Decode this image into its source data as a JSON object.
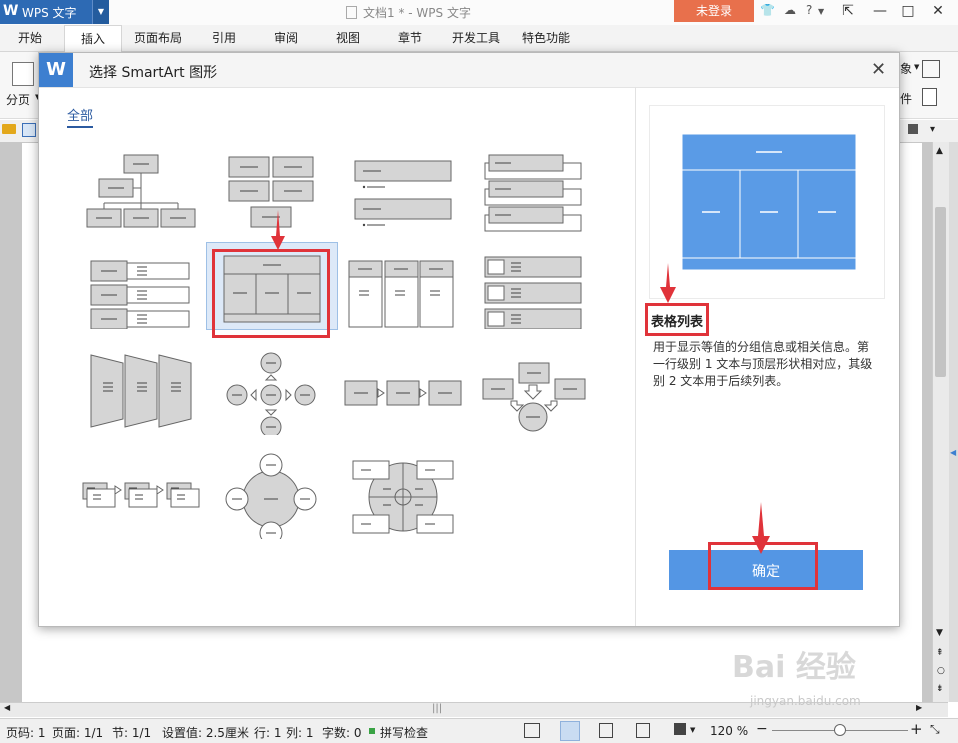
{
  "app": {
    "logo": "W",
    "name": "WPS 文字",
    "doc_title": "文档1 * - WPS 文字",
    "login": "未登录",
    "help": "?"
  },
  "tabs": [
    "开始",
    "插入",
    "页面布局",
    "引用",
    "审阅",
    "视图",
    "章节",
    "开发工具",
    "特色功能"
  ],
  "active_tab": "插入",
  "ribbon": {
    "page_break": "分页"
  },
  "dialog": {
    "title": "选择 SmartArt 图形",
    "category": "全部",
    "selected_name": "表格列表",
    "description": "用于显示等值的分组信息或相关信息。第一行级别 1 文本与顶层形状相对应，其级别 2 文本用于后续列表。",
    "ok_label": "确定",
    "thumbnails": [
      "organization-chart",
      "hierarchy-list",
      "vertical-bullet-list",
      "stacked-list",
      "horizontal-bullet-list",
      "table-list",
      "vertical-box-list",
      "picture-list",
      "trapezoid-list",
      "radial-cycle",
      "basic-process",
      "converging-arrows",
      "continuous-block-process",
      "basic-radial",
      "cycle-matrix"
    ]
  },
  "status": {
    "page_num": "页码: 1",
    "pages": "页面: 1/1",
    "section": "节: 1/1",
    "setting": "设置值: 2.5厘米",
    "row": "行: 1",
    "col": "列: 1",
    "words": "字数: 0",
    "spell": "拼写检查",
    "zoom": "120 %"
  },
  "watermark": {
    "brand": "Bai 经验",
    "url": "jingyan.baidu.com"
  },
  "colors": {
    "accent": "#5496e4",
    "highlight": "#e0333a",
    "titlebar": "#2d6ab4",
    "login": "#e8704c"
  }
}
